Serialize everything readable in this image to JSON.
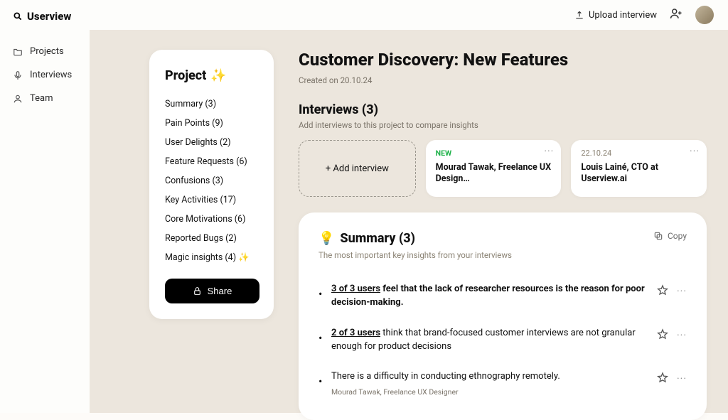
{
  "brand": "Userview",
  "topbar": {
    "upload_label": "Upload interview"
  },
  "sidebar": {
    "items": [
      {
        "label": "Projects"
      },
      {
        "label": "Interviews"
      },
      {
        "label": "Team"
      }
    ]
  },
  "project_panel": {
    "title": "Project",
    "nav": [
      "Summary (3)",
      "Pain Points (9)",
      "User Delights (2)",
      "Feature Requests (6)",
      "Confusions (3)",
      "Key Activities (17)",
      "Core Motivations (6)",
      "Reported Bugs (2)",
      "Magic insights (4) ✨"
    ],
    "share_label": "Share"
  },
  "page": {
    "title": "Customer Discovery: New Features",
    "created": "Created on 20.10.24"
  },
  "interviews": {
    "heading": "Interviews (3)",
    "sub": "Add interviews to this project to compare insights",
    "add_label": "+ Add interview",
    "cards": [
      {
        "badge": "NEW",
        "title": "Mourad Tawak, Freelance UX Design…"
      },
      {
        "date": "22.10.24",
        "title": "Louis Lainé, CTO at Userview.ai"
      }
    ]
  },
  "summary": {
    "title": "Summary (3)",
    "sub": "The most important key insights from your interviews",
    "copy_label": "Copy",
    "items": [
      {
        "ratio": "3 of 3 users",
        "rest": " feel that the lack of researcher resources is the reason for poor decision-making.",
        "bold": true
      },
      {
        "ratio": "2 of 3 users",
        "rest": " think that brand-focused customer interviews are not granular enough for product decisions",
        "bold": false
      },
      {
        "plain": "There is a difficulty in conducting ethnography remotely.",
        "caption": "Mourad Tawak, Freelance UX Designer"
      }
    ]
  }
}
